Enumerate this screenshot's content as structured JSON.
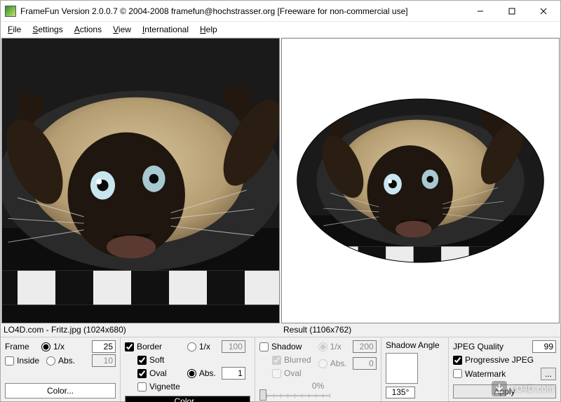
{
  "window": {
    "title": "FrameFun Version 2.0.0.7 © 2004-2008 framefun@hochstrasser.org [Freeware for non-commercial use]"
  },
  "menu": {
    "file": "File",
    "settings": "Settings",
    "actions": "Actions",
    "view": "View",
    "international": "International",
    "help": "Help"
  },
  "status": {
    "left": "LO4D.com - Fritz.jpg (1024x680)",
    "right": "Result (1106x762)"
  },
  "frame": {
    "label": "Frame",
    "one_over_x": "1/x",
    "one_over_x_val": "25",
    "inside": "Inside",
    "abs": "Abs.",
    "abs_val": "10",
    "color_btn": "Color..."
  },
  "border": {
    "border": "Border",
    "soft": "Soft",
    "oval": "Oval",
    "vignette": "Vignette",
    "one_over_x": "1/x",
    "one_over_x_val": "100",
    "abs": "Abs.",
    "abs_val": "1",
    "color_btn": "Color..."
  },
  "shadow": {
    "shadow": "Shadow",
    "blurred": "Blurred",
    "oval": "Oval",
    "one_over_x": "1/x",
    "one_over_x_val": "200",
    "abs": "Abs.",
    "abs_val": "0",
    "percent": "0%",
    "angle_label": "Shadow Angle",
    "angle_val": "135°"
  },
  "jpeg": {
    "quality_label": "JPEG Quality",
    "quality_val": "99",
    "progressive": "Progressive JPEG",
    "watermark": "Watermark",
    "dots": "...",
    "apply": "Apply"
  },
  "overlay": {
    "site": "LO4D.com"
  }
}
